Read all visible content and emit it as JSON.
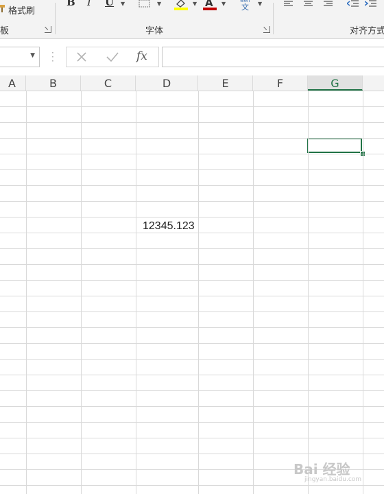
{
  "ribbon": {
    "format_painter_label": "格式刷",
    "clipboard_group_label": "板",
    "font_group_label": "字体",
    "alignment_group_label": "对齐方式",
    "bold_label": "B",
    "italic_label": "I",
    "underline_label": "U",
    "wen_label": "文",
    "font_color": "#c00000",
    "fill_color": "#ffff00",
    "launcher_symbol": "↘"
  },
  "formula_bar": {
    "name_box_value": "",
    "fx_label": "fx",
    "formula_value": ""
  },
  "columns": [
    "A",
    "B",
    "C",
    "D",
    "E",
    "F",
    "G"
  ],
  "selected_column": "G",
  "cell": {
    "value": "12345.123",
    "column": "D"
  },
  "accent_color": "#217346",
  "watermark": {
    "text": "Bai 经验",
    "url": "jingyan.baidu.com"
  }
}
